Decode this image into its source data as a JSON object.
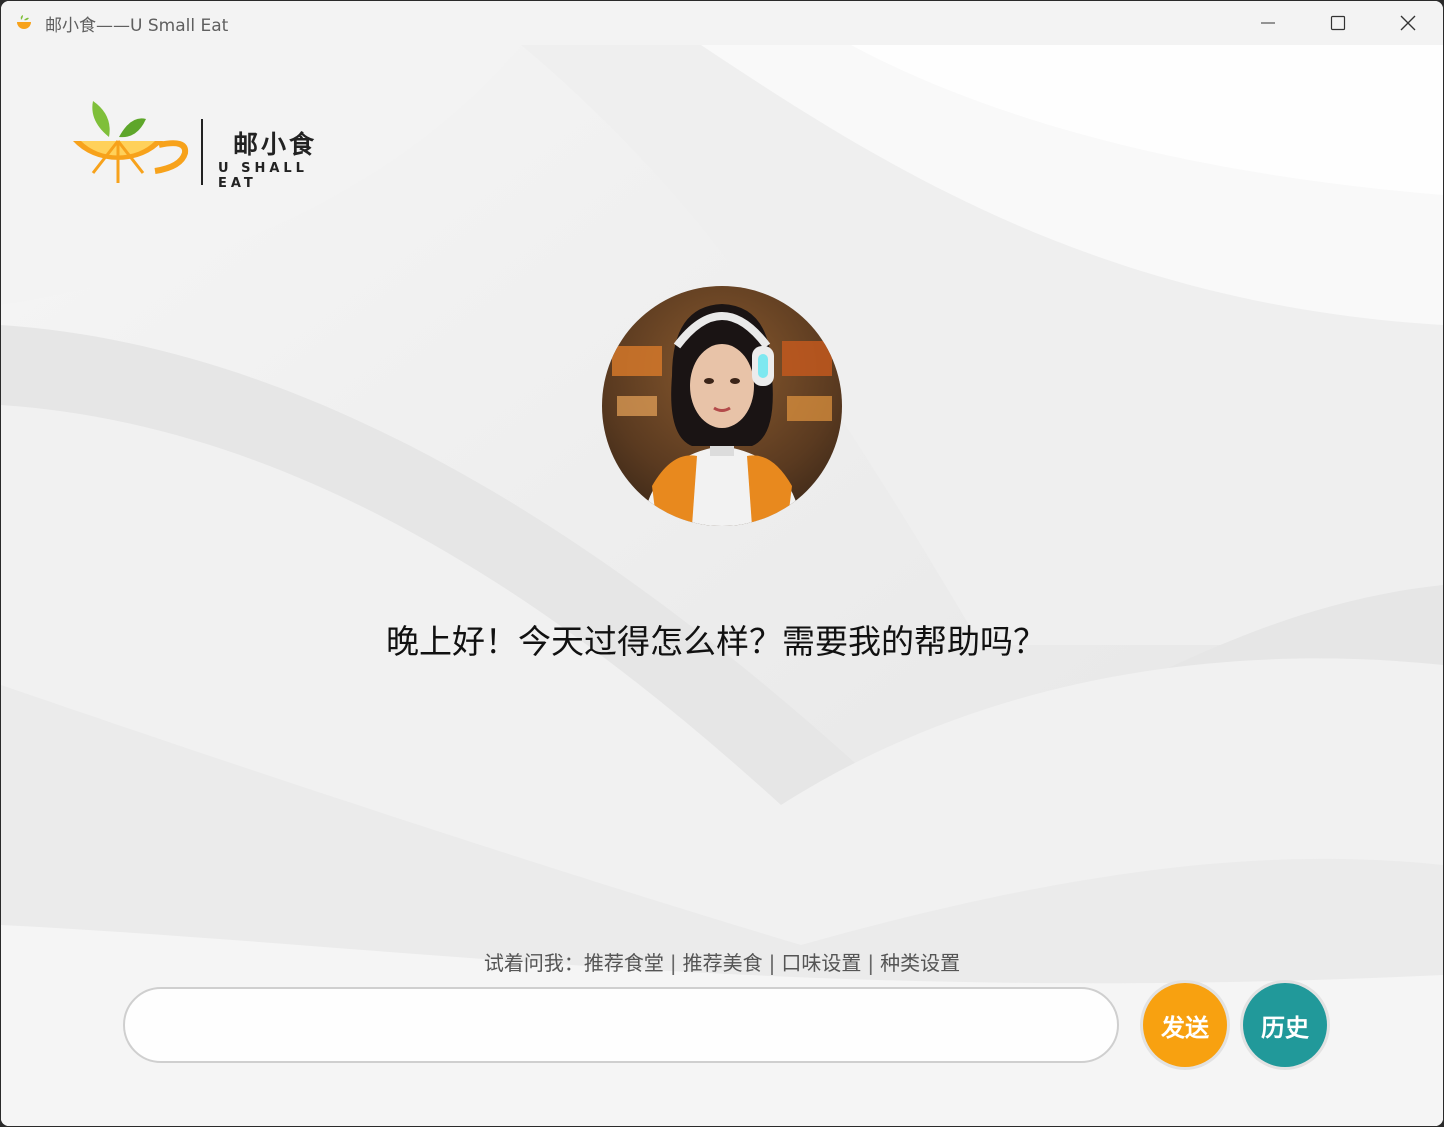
{
  "window": {
    "title": "邮小食——U Small Eat"
  },
  "logo": {
    "name_cn": "邮小食",
    "name_en": "U SHALL EAT"
  },
  "greeting": "晚上好！今天过得怎么样？需要我的帮助吗？",
  "suggestions": {
    "prefix": "试着问我：",
    "items": [
      "推荐食堂",
      "推荐美食",
      "口味设置",
      "种类设置"
    ],
    "separator": "|"
  },
  "input": {
    "value": "",
    "placeholder": ""
  },
  "buttons": {
    "send": "发送",
    "history": "历史"
  },
  "colors": {
    "send": "#f8a110",
    "history": "#21999a",
    "orange": "#f7a21b",
    "leaf": "#7fbf3a"
  },
  "icons": {
    "minimize": "minimize-icon",
    "maximize": "maximize-icon",
    "close": "close-icon"
  }
}
